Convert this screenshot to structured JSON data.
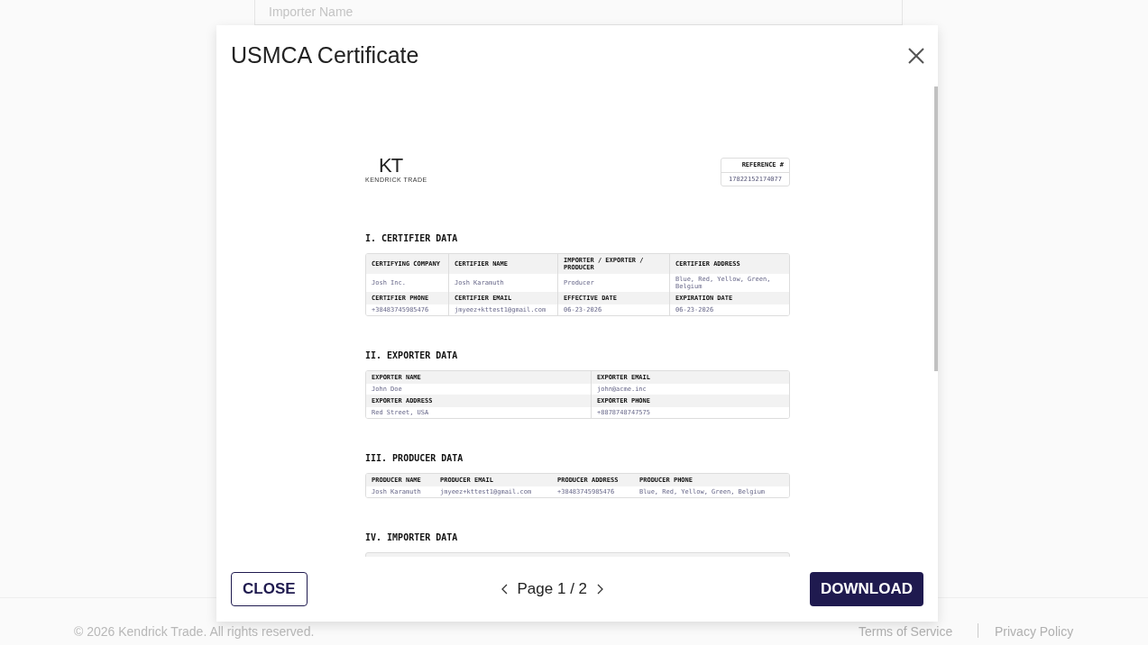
{
  "background": {
    "field_placeholder": "Importer Name",
    "footer": {
      "copyright": "© 2026 Kendrick Trade. All rights reserved.",
      "links": [
        "Terms of Service",
        "Privacy Policy"
      ]
    }
  },
  "modal": {
    "title": "USMCA Certificate",
    "document": {
      "logo": {
        "mark": "KT",
        "name": "KENDRICK TRADE"
      },
      "reference": {
        "label": "REFERENCE #",
        "value": "17822152174077"
      },
      "sections": [
        {
          "title": "I. CERTIFIER DATA",
          "kind": "four_col",
          "rows": [
            {
              "kind": "header",
              "cells": [
                "CERTIFYING COMPANY",
                "CERTIFIER NAME",
                "IMPORTER / EXPORTER / PRODUCER",
                "CERTIFIER ADDRESS"
              ]
            },
            {
              "kind": "value",
              "cells": [
                "Josh Inc.",
                "Josh Karamuth",
                "Producer",
                "Blue, Red, Yellow, Green, Belgium"
              ]
            },
            {
              "kind": "header",
              "cells": [
                "CERTIFIER PHONE",
                "CERTIFIER EMAIL",
                "EFFECTIVE DATE",
                "EXPIRATION DATE"
              ]
            },
            {
              "kind": "value",
              "cells": [
                "+38483745985476",
                "jmyeez+kttest1@gmail.com",
                "06-23-2026",
                "06-23-2026"
              ]
            }
          ]
        },
        {
          "title": "II. EXPORTER DATA",
          "kind": "two_col",
          "rows": [
            {
              "kind": "header",
              "cells": [
                "EXPORTER NAME",
                "EXPORTER EMAIL"
              ]
            },
            {
              "kind": "value",
              "cells": [
                "John Doe",
                "john@acme.inc"
              ]
            },
            {
              "kind": "header",
              "cells": [
                "EXPORTER ADDRESS",
                "EXPORTER PHONE"
              ]
            },
            {
              "kind": "value",
              "cells": [
                "Red Street, USA",
                "+8878748747575"
              ]
            }
          ]
        },
        {
          "title": "III. PRODUCER DATA",
          "kind": "auto_col",
          "rows": [
            {
              "kind": "header",
              "cells": [
                "PRODUCER NAME",
                "PRODUCER EMAIL",
                "PRODUCER ADDRESS",
                "PRODUCER PHONE"
              ]
            },
            {
              "kind": "value",
              "cells": [
                "Josh Karamuth",
                "jmyeez+kttest1@gmail.com",
                "+38483745985476",
                "Blue, Red, Yellow, Green, Belgium"
              ]
            }
          ]
        },
        {
          "title": "IV. IMPORTER DATA",
          "kind": "two_col"
        }
      ]
    },
    "pager": {
      "label": "Page 1 / 2"
    },
    "buttons": [
      {
        "label": "CLOSE",
        "kind": "outline"
      },
      {
        "label": "DOWNLOAD",
        "kind": "primary"
      }
    ]
  }
}
